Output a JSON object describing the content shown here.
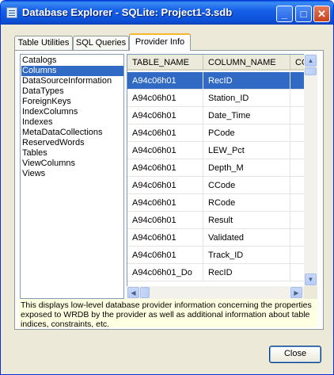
{
  "window": {
    "title": "Database Explorer - SQLite: Project1-3.sdb",
    "minimize": "_",
    "maximize": "□",
    "close": "✕"
  },
  "tabs": [
    {
      "label": "Table Utilities",
      "active": false
    },
    {
      "label": "SQL Queries",
      "active": false
    },
    {
      "label": "Provider Info",
      "active": true
    }
  ],
  "collections": [
    "Catalogs",
    "Columns",
    "DataSourceInformation",
    "DataTypes",
    "ForeignKeys",
    "IndexColumns",
    "Indexes",
    "MetaDataCollections",
    "ReservedWords",
    "Tables",
    "ViewColumns",
    "Views"
  ],
  "selected_collection": "Columns",
  "grid": {
    "columns": [
      "TABLE_NAME",
      "COLUMN_NAME",
      "CO"
    ],
    "rows": [
      [
        "A94c06h01",
        "RecID",
        ""
      ],
      [
        "A94c06h01",
        "Station_ID",
        ""
      ],
      [
        "A94c06h01",
        "Date_Time",
        ""
      ],
      [
        "A94c06h01",
        "PCode",
        ""
      ],
      [
        "A94c06h01",
        "LEW_Pct",
        ""
      ],
      [
        "A94c06h01",
        "Depth_M",
        ""
      ],
      [
        "A94c06h01",
        "CCode",
        ""
      ],
      [
        "A94c06h01",
        "RCode",
        ""
      ],
      [
        "A94c06h01",
        "Result",
        ""
      ],
      [
        "A94c06h01",
        "Validated",
        ""
      ],
      [
        "A94c06h01",
        "Track_ID",
        ""
      ],
      [
        "A94c06h01_Do",
        "RecID",
        ""
      ]
    ],
    "selected_row": 0
  },
  "scroll": {
    "up": "▲",
    "down": "▼",
    "left": "◀",
    "right": "▶"
  },
  "description": "This displays low-level database provider information concerning the properties exposed to WRDB by the provider as well as additional information about table indices, constraints, etc.",
  "buttons": {
    "close": "Close"
  },
  "colors": {
    "titlebar": "#0b4fd6",
    "selection": "#316ac5",
    "description_bg": "#ffffe1"
  }
}
